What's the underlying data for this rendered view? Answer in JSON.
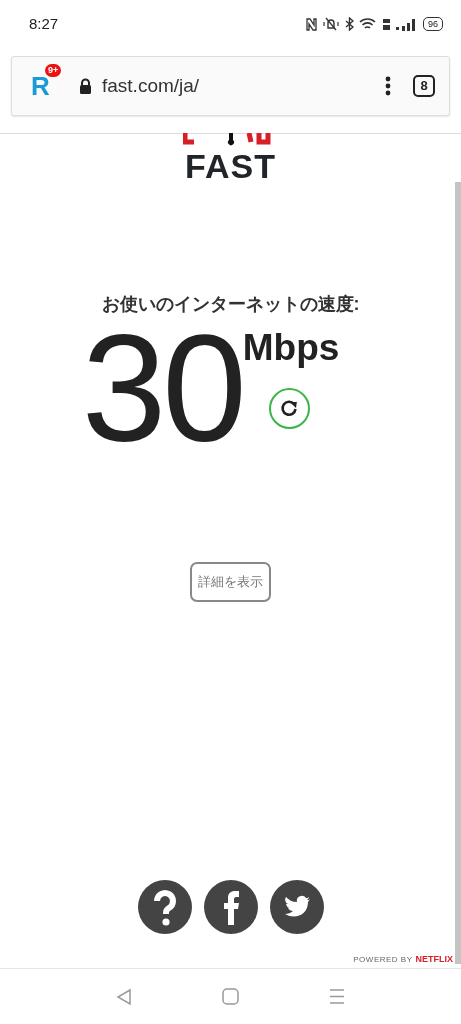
{
  "status_bar": {
    "time": "8:27",
    "battery": "96"
  },
  "browser": {
    "app_logo": "R",
    "notification_badge": "9+",
    "url": "fast.com/ja/",
    "tab_count": "8"
  },
  "page": {
    "logo": "FAST",
    "heading": "お使いのインターネットの速度:",
    "speed": "30",
    "unit": "Mbps",
    "details_button": "詳細を表示",
    "powered_by": "POWERED BY",
    "brand": "NETFLIX"
  }
}
